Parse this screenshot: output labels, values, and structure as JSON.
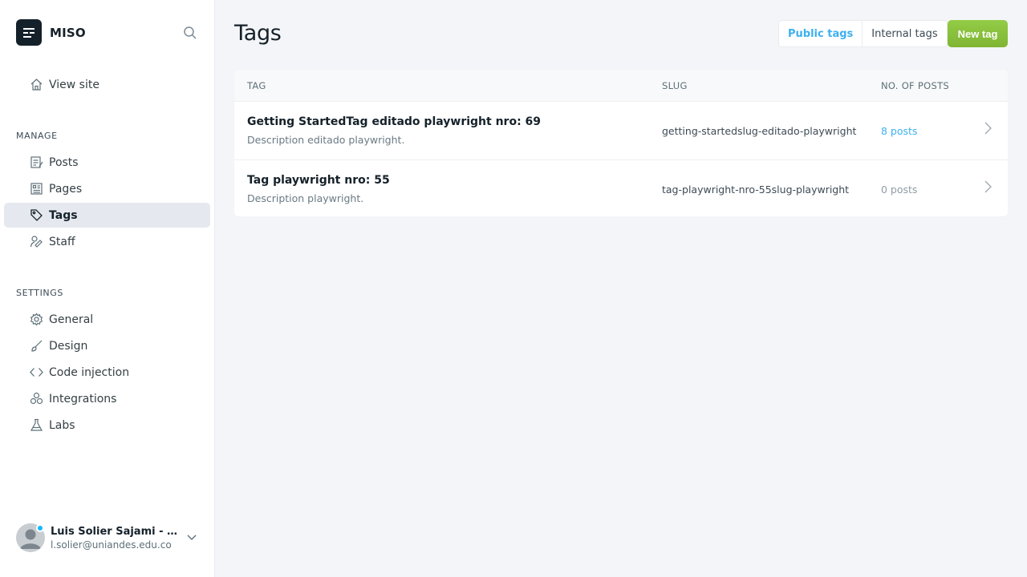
{
  "brand": {
    "name": "MISO"
  },
  "sidebar": {
    "view_site": "View site",
    "manage_heading": "MANAGE",
    "manage_items": [
      {
        "label": "Posts",
        "icon": "posts-icon"
      },
      {
        "label": "Pages",
        "icon": "pages-icon"
      },
      {
        "label": "Tags",
        "icon": "tag-icon",
        "active": true
      },
      {
        "label": "Staff",
        "icon": "staff-icon"
      }
    ],
    "settings_heading": "SETTINGS",
    "settings_items": [
      {
        "label": "General",
        "icon": "gear-icon"
      },
      {
        "label": "Design",
        "icon": "brush-icon"
      },
      {
        "label": "Code injection",
        "icon": "code-icon"
      },
      {
        "label": "Integrations",
        "icon": "integrations-icon"
      },
      {
        "label": "Labs",
        "icon": "flask-icon"
      }
    ],
    "user": {
      "name": "Luis Solier Sajami - Edi...",
      "email": "l.solier@uniandes.edu.co"
    }
  },
  "main": {
    "title": "Tags",
    "tabs": [
      {
        "label": "Public tags",
        "active": true
      },
      {
        "label": "Internal tags",
        "active": false
      }
    ],
    "new_button": "New tag",
    "table": {
      "headers": {
        "tag": "TAG",
        "slug": "SLUG",
        "posts": "NO. OF POSTS"
      },
      "rows": [
        {
          "name": "Getting StartedTag editado playwright nro: 69",
          "description": "Description editado playwright.",
          "slug": "getting-startedslug-editado-playwright",
          "posts": "8 posts"
        },
        {
          "name": "Tag playwright nro: 55",
          "description": "Description playwright.",
          "slug": "tag-playwright-nro-55slug-playwright",
          "posts": "0 posts"
        }
      ]
    }
  },
  "colors": {
    "accent_blue": "#3eb0ef",
    "button_green": "#8ac23e",
    "muted_gray": "#8e9ca6",
    "active_nav_bg": "#e5e9ef"
  }
}
